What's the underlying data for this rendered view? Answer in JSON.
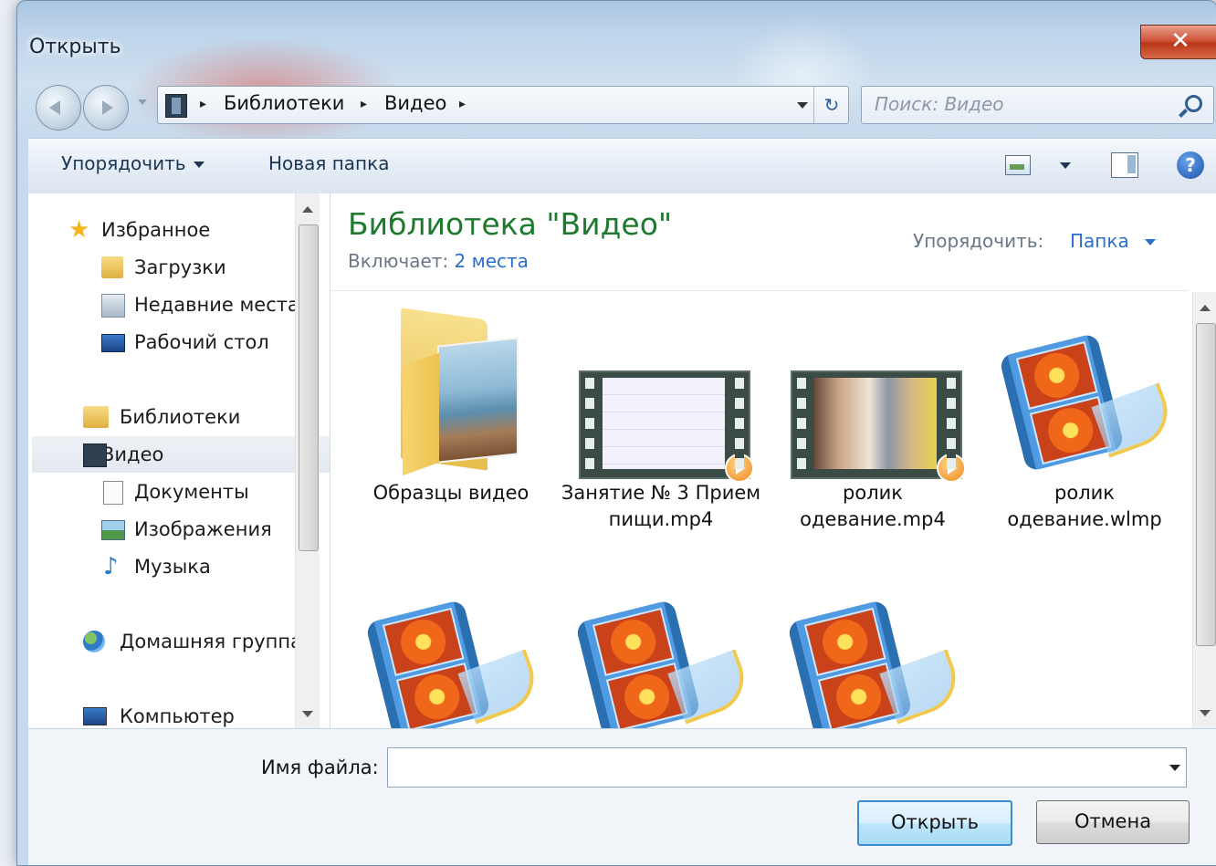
{
  "window": {
    "title": "Открыть",
    "close_glyph": "✕"
  },
  "address": {
    "crumbs": [
      "Библиотеки",
      "Видео"
    ],
    "separator": "▸",
    "refresh_glyph": "↻"
  },
  "search": {
    "placeholder": "Поиск: Видео"
  },
  "toolbar": {
    "organize": "Упорядочить",
    "new_folder": "Новая папка",
    "help": "?"
  },
  "nav": {
    "favorites": "Избранное",
    "downloads": "Загрузки",
    "recent": "Недавние места",
    "desktop": "Рабочий стол",
    "libraries": "Библиотеки",
    "video": "Видео",
    "documents": "Документы",
    "images": "Изображения",
    "music": "Музыка",
    "homegroup": "Домашняя группа",
    "computer": "Компьютер"
  },
  "library": {
    "title": "Библиотека \"Видео\"",
    "includes_label": "Включает:",
    "includes_link": "2 места",
    "arrange_label": "Упорядочить:",
    "arrange_value": "Папка"
  },
  "files": [
    {
      "name": "Образцы видео",
      "kind": "folder"
    },
    {
      "name": "Занятие № 3 Прием пищи.mp4",
      "kind": "video-blank"
    },
    {
      "name": "ролик одевание.mp4",
      "kind": "video-photo"
    },
    {
      "name": "ролик одевание.wlmp",
      "kind": "wlmp"
    },
    {
      "name": "",
      "kind": "wlmp"
    },
    {
      "name": "",
      "kind": "wlmp"
    },
    {
      "name": "",
      "kind": "wlmp"
    }
  ],
  "footer": {
    "filename_label": "Имя файла:",
    "filename_value": "",
    "open_button": "Открыть",
    "cancel_button": "Отмена"
  }
}
